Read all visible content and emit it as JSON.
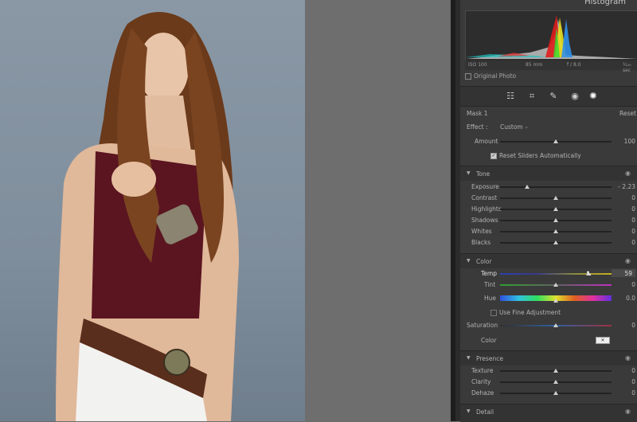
{
  "histogram": {
    "title": "Histogram",
    "iso": "ISO 100",
    "focal": "85 mm",
    "aperture": "f / 8.0",
    "shutter": "¹⁄₁₂₅ sec",
    "original_photo_label": "Original Photo"
  },
  "mask": {
    "title": "Mask 1",
    "reset": "Reset",
    "effect_label": "Effect :",
    "effect_value": "Custom",
    "amount_label": "Amount",
    "amount_value": "100",
    "reset_sliders_label": "Reset Sliders Automatically"
  },
  "tone": {
    "title": "Tone",
    "sliders": [
      {
        "label": "Exposure",
        "value": "- 2.23",
        "level": 0.24
      },
      {
        "label": "Contrast",
        "value": "0",
        "level": 0.5
      },
      {
        "label": "Highlights",
        "value": "0",
        "level": 0.5
      },
      {
        "label": "Shadows",
        "value": "0",
        "level": 0.5
      },
      {
        "label": "Whites",
        "value": "0",
        "level": 0.5
      },
      {
        "label": "Blacks",
        "value": "0",
        "level": 0.5
      }
    ]
  },
  "color": {
    "title": "Color",
    "temp_label": "Temp",
    "temp_value": "59",
    "temp_level": 0.79,
    "tint_label": "Tint",
    "tint_value": "0",
    "hue_label": "Hue",
    "hue_value": "0.0",
    "fine_adjust_label": "Use Fine Adjustment",
    "saturation_label": "Saturation",
    "saturation_value": "0",
    "color_label": "Color"
  },
  "presence": {
    "title": "Presence",
    "sliders": [
      {
        "label": "Texture",
        "value": "0",
        "level": 0.5
      },
      {
        "label": "Clarity",
        "value": "0",
        "level": 0.5
      },
      {
        "label": "Dehaze",
        "value": "0",
        "level": 0.5
      }
    ]
  },
  "detail": {
    "title": "Detail"
  },
  "colors": {
    "panel_bg": "#3a3a3a",
    "photo_bg": "#8a98a6"
  }
}
